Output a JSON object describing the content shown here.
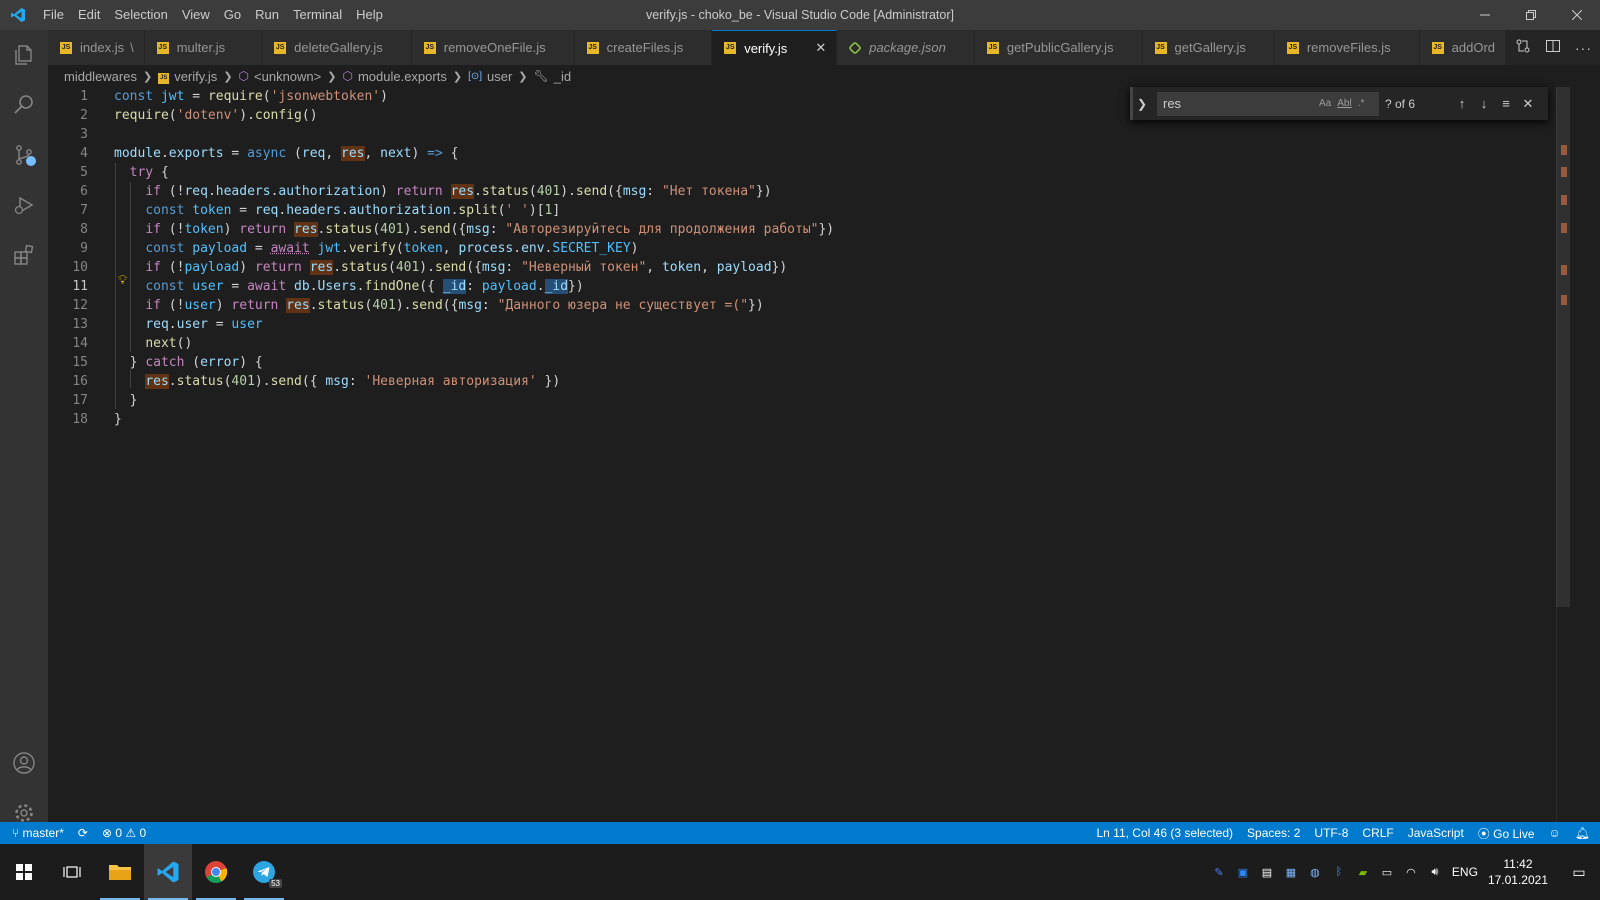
{
  "window": {
    "title": "verify.js - choko_be - Visual Studio Code [Administrator]",
    "menu": [
      "File",
      "Edit",
      "Selection",
      "View",
      "Go",
      "Run",
      "Terminal",
      "Help"
    ]
  },
  "tabs": [
    {
      "label": "index.js",
      "suffix": "\\",
      "type": "js"
    },
    {
      "label": "multer.js",
      "type": "js"
    },
    {
      "label": "deleteGallery.js",
      "type": "js"
    },
    {
      "label": "removeOneFile.js",
      "type": "js"
    },
    {
      "label": "createFiles.js",
      "type": "js"
    },
    {
      "label": "verify.js",
      "type": "js",
      "active": true
    },
    {
      "label": "package.json",
      "type": "json"
    },
    {
      "label": "getPublicGallery.js",
      "type": "js"
    },
    {
      "label": "getGallery.js",
      "type": "js"
    },
    {
      "label": "removeFiles.js",
      "type": "js"
    },
    {
      "label": "addOrd",
      "type": "js"
    }
  ],
  "breadcrumbs": {
    "folder": "middlewares",
    "file": "verify.js",
    "symbol1": "<unknown>",
    "symbol2": "module.exports",
    "symbol3": "user",
    "symbol4": "_id"
  },
  "find": {
    "value": "res",
    "match_case": "Aa",
    "whole_word": "Abl",
    "regex": ".*",
    "count": "? of 6"
  },
  "editor": {
    "current_line": 11,
    "line_numbers": [
      "1",
      "2",
      "3",
      "4",
      "5",
      "6",
      "7",
      "8",
      "9",
      "10",
      "11",
      "12",
      "13",
      "14",
      "15",
      "16",
      "17",
      "18"
    ],
    "strings": {
      "jsonwebtoken": "'jsonwebtoken'",
      "dotenv": "'dotenv'",
      "no_token": "\"Нет токена\"",
      "space": "' '",
      "authorize": "\"Авторезируйтесь для продолжения работы\"",
      "bad_token": "\"Неверный токен\"",
      "no_user": "\"Данного юзера не существует =(\"",
      "bad_auth": "'Неверная авторизация'"
    }
  },
  "statusbar": {
    "branch": "master*",
    "errors": "0",
    "warnings": "0",
    "position": "Ln 11, Col 46 (3 selected)",
    "spaces": "Spaces: 2",
    "encoding": "UTF-8",
    "eol": "CRLF",
    "language": "JavaScript",
    "golive": "Go Live"
  },
  "taskbar": {
    "time": "11:42",
    "date": "17.01.2021",
    "lang": "ENG",
    "telegram_badge": "53"
  },
  "colors": {
    "accent": "#007acc",
    "find_highlight": "#ea5c00",
    "selection": "#264f78",
    "js_icon": "#e8b728"
  }
}
